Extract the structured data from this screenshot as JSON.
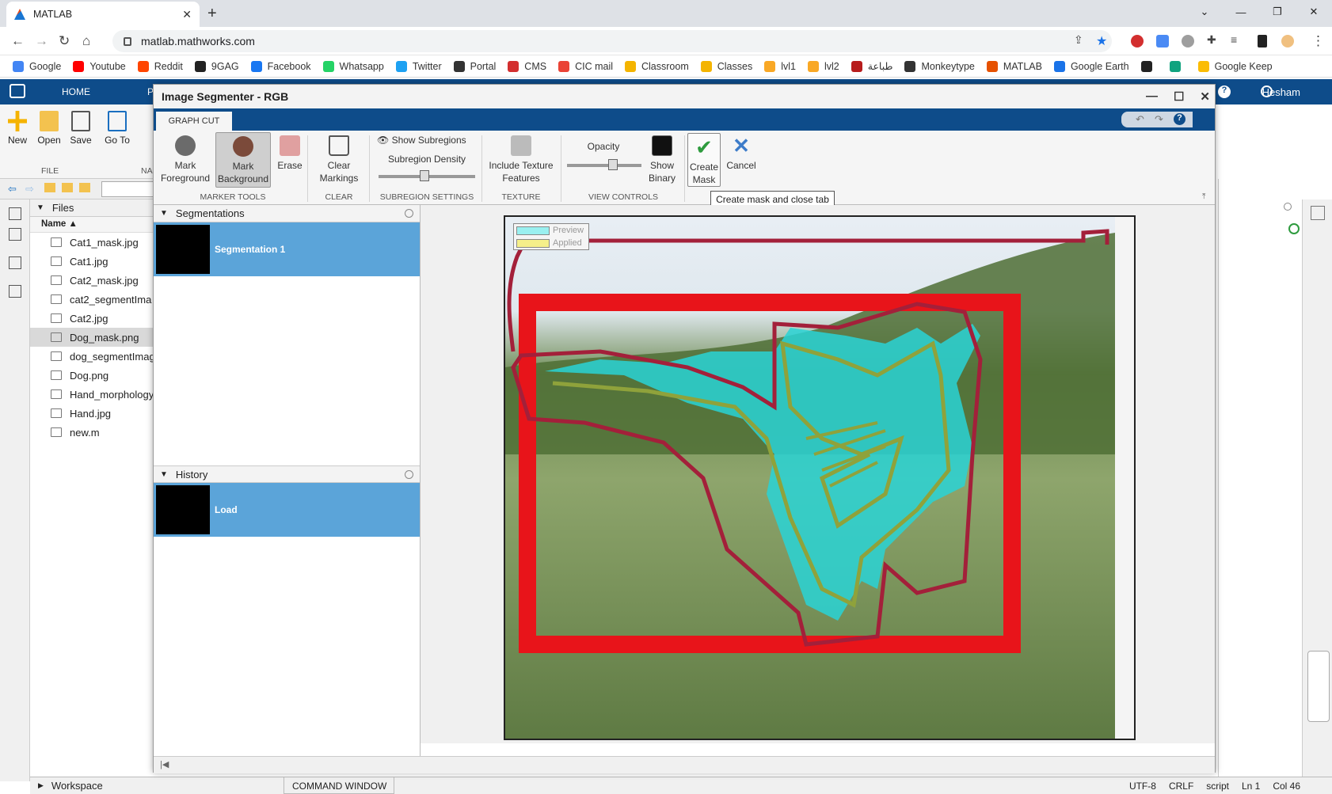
{
  "browser": {
    "tab_title": "MATLAB",
    "url": "matlab.mathworks.com",
    "bookmarks": [
      "Google",
      "Youtube",
      "Reddit",
      "9GAG",
      "Facebook",
      "Whatsapp",
      "Twitter",
      "Portal",
      "CMS",
      "CIC mail",
      "Classroom",
      "Classes",
      "lvl1",
      "lvl2",
      "طباعة",
      "Monkeytype",
      "MATLAB",
      "Google Earth",
      "",
      "",
      "Google Keep"
    ],
    "bookmark_colors": [
      "#4285f4",
      "#ff0000",
      "#ff4500",
      "#222222",
      "#1877f2",
      "#25d366",
      "#1da1f2",
      "#333333",
      "#d32f2f",
      "#ea4335",
      "#f4b400",
      "#f4b400",
      "#f9a825",
      "#f9a825",
      "#b71c1c",
      "#333333",
      "#e65100",
      "#1a73e8",
      "#222222",
      "#10a37f",
      "#fbbc04"
    ]
  },
  "matlab": {
    "home_tab": "HOME",
    "plots_tab": "P",
    "user": "Hesham",
    "toolbar": {
      "new": "New",
      "open": "Open",
      "save": "Save",
      "goto": "Go To",
      "file_group": "FILE",
      "nav_group": "NA"
    },
    "files_panel": {
      "title": "Files",
      "col_name": "Name",
      "files": [
        "Cat1_mask.jpg",
        "Cat1.jpg",
        "Cat2_mask.jpg",
        "cat2_segmentIma",
        "Cat2.jpg",
        "Dog_mask.png",
        "dog_segmentImag",
        "Dog.png",
        "Hand_morphology",
        "Hand.jpg",
        "new.m"
      ]
    },
    "workspace": "Workspace",
    "command_window": "COMMAND WINDOW",
    "status": {
      "encoding": "UTF-8",
      "eol": "CRLF",
      "type": "script",
      "ln": "Ln 1",
      "col": "Col 46"
    }
  },
  "segmenter": {
    "title": "Image Segmenter - RGB",
    "tab": "GRAPH CUT",
    "ribbon": {
      "mark_fg": [
        "Mark",
        "Foreground"
      ],
      "mark_bg": [
        "Mark",
        "Background"
      ],
      "erase": "Erase",
      "marker_tools": "MARKER TOOLS",
      "clear_markings": [
        "Clear",
        "Markings"
      ],
      "clear_group": "CLEAR",
      "show_subregions": "Show Subregions",
      "subregion_density": "Subregion Density",
      "subregion_group": "SUBREGION SETTINGS",
      "include_texture": [
        "Include Texture",
        "Features"
      ],
      "texture_group": "TEXTURE",
      "opacity": "Opacity",
      "show_binary": [
        "Show",
        "Binary"
      ],
      "view_group": "VIEW CONTROLS",
      "create_mask": [
        "Create",
        "Mask"
      ],
      "cancel": "Cancel"
    },
    "tooltip": "Create mask and close tab",
    "segmentations_title": "Segmentations",
    "segmentation_item": "Segmentation 1",
    "history_title": "History",
    "history_item": "Load",
    "legend": {
      "preview": "Preview",
      "applied": "Applied"
    }
  }
}
